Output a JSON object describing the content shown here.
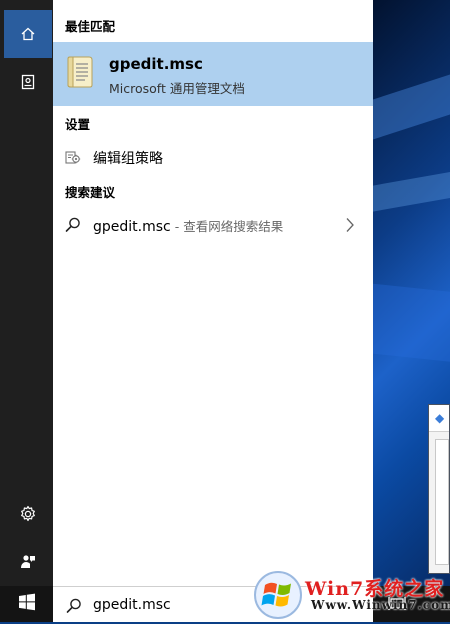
{
  "rail": {
    "items": [
      {
        "icon": "home-icon",
        "active": true
      },
      {
        "icon": "notebook-icon",
        "active": false
      },
      {
        "icon": "gear-icon",
        "active": false
      },
      {
        "icon": "feedback-icon",
        "active": false
      }
    ]
  },
  "results": {
    "best_match_header": "最佳匹配",
    "best_match": {
      "title": "gpedit.msc",
      "subtitle": "Microsoft 通用管理文档",
      "icon": "document-icon"
    },
    "settings_header": "设置",
    "settings_items": [
      {
        "label": "编辑组策略",
        "icon": "policy-gear-icon"
      }
    ],
    "suggestions_header": "搜索建议",
    "suggestions": [
      {
        "query": "gpedit.msc",
        "hint": " - 查看网络搜索结果",
        "icon": "search-icon"
      }
    ]
  },
  "taskbar": {
    "search_value": "gpedit.msc",
    "search_placeholder": "",
    "start_icon": "windows-logo-icon",
    "task_view_icon": "task-view-icon"
  },
  "watermark": {
    "line1": "Win7系统之家",
    "line2": "Www.Winwin7.com"
  },
  "colors": {
    "rail_bg": "#1f1f1f",
    "rail_active": "#2a5d9e",
    "selection": "#aed0ef",
    "taskbar_bg": "#141414"
  }
}
